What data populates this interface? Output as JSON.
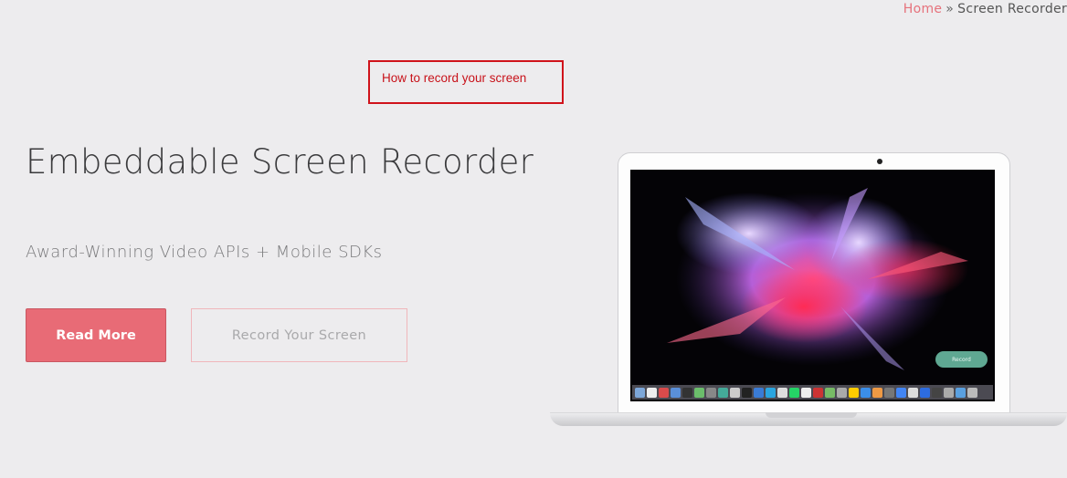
{
  "breadcrumb": {
    "home": "Home",
    "separator": "»",
    "current": "Screen Recorder"
  },
  "annotation": {
    "label": "How to record your screen",
    "border_color": "#d0131b"
  },
  "hero": {
    "title": "Embeddable Screen Recorder",
    "subtitle": "Award-Winning Video APIs + Mobile SDKs",
    "primary_button": "Read More",
    "secondary_button": "Record Your Screen"
  },
  "laptop_screen": {
    "record_button": "Record"
  },
  "colors": {
    "accent": "#e86b76",
    "background": "#edecee",
    "record_pill": "#5fa892"
  }
}
